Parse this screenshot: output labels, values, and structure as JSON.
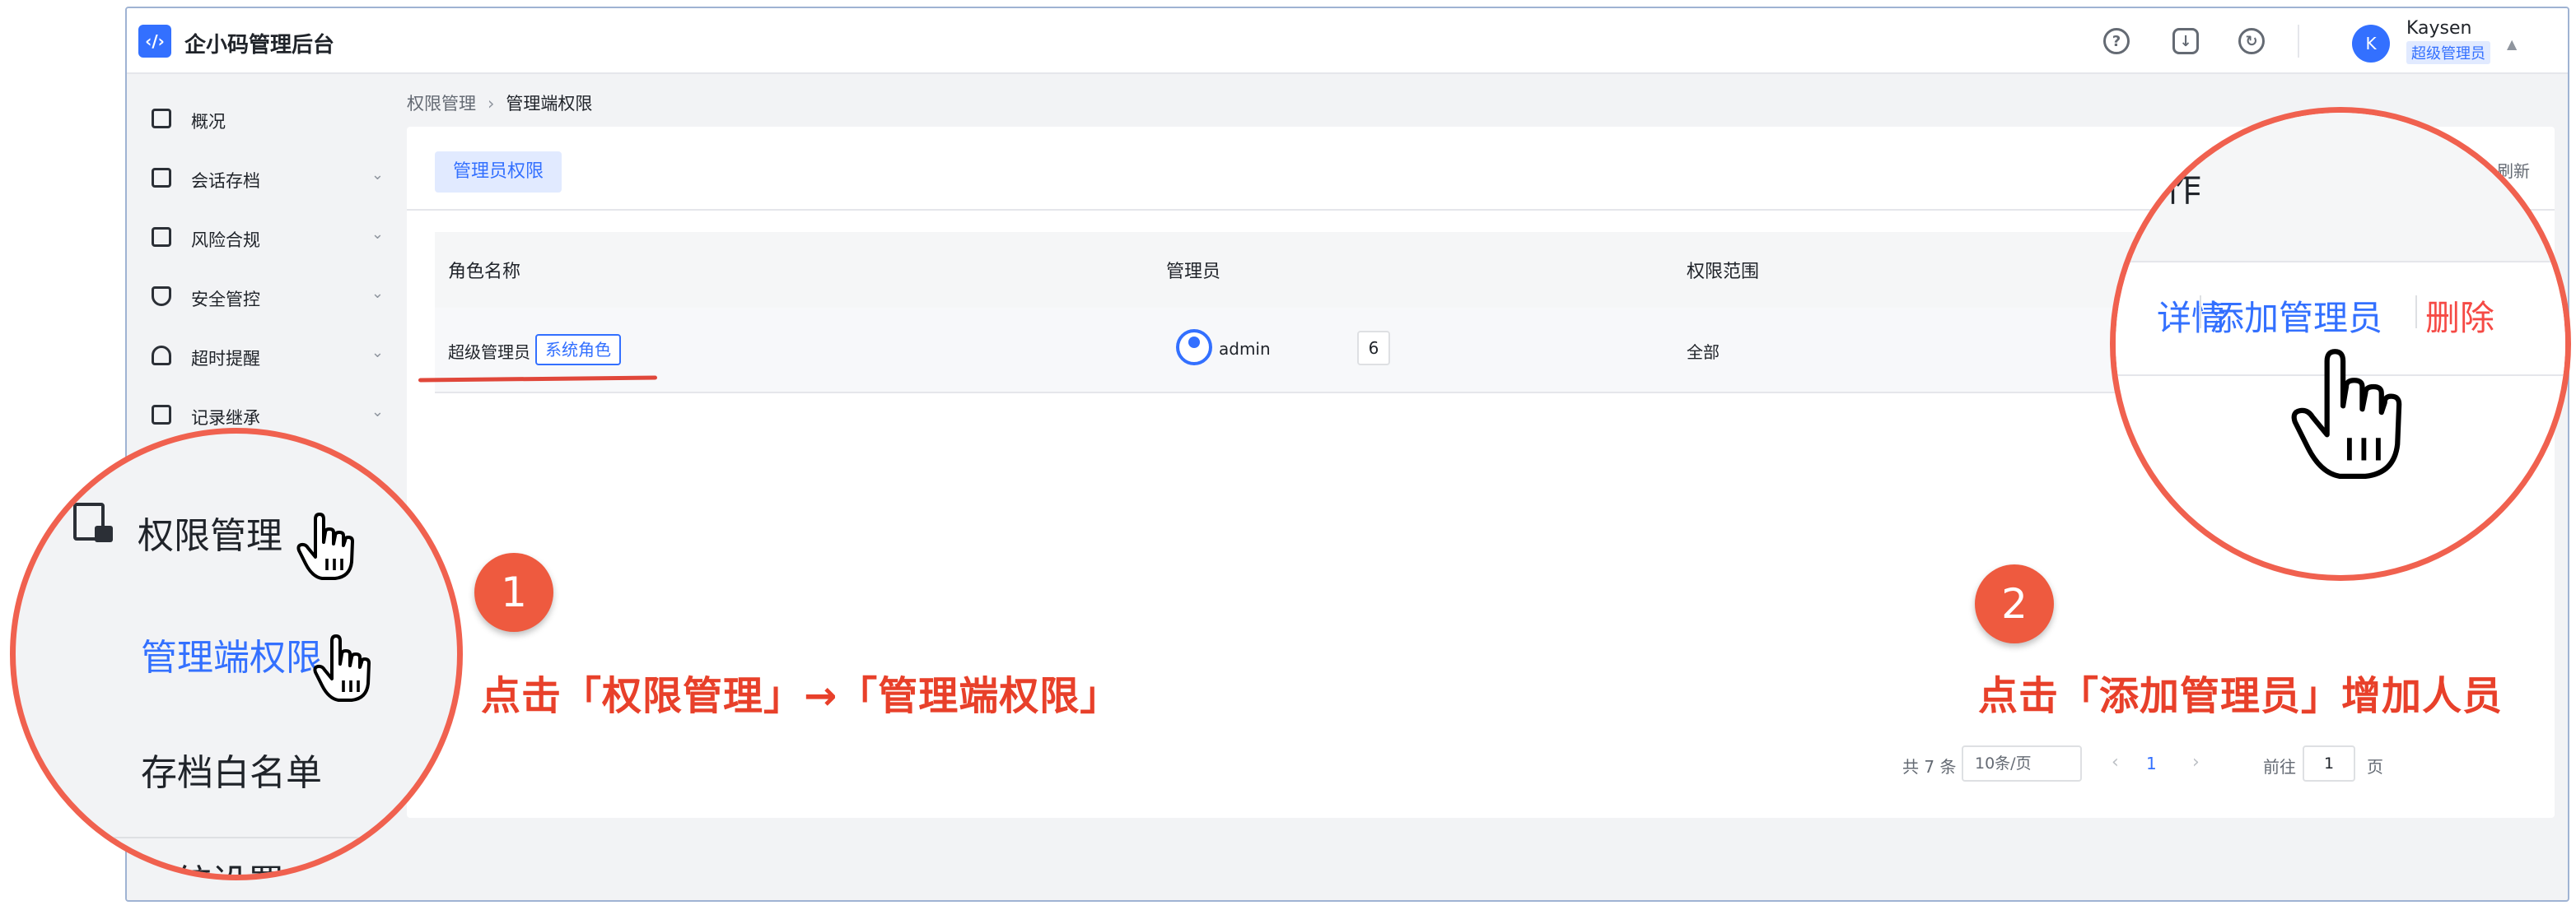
{
  "app": {
    "logo_glyph": "‹/›",
    "title": "企小码管理后台"
  },
  "header": {
    "icons": [
      "help-icon",
      "download-icon",
      "refresh-icon"
    ],
    "user": {
      "avatar_letter": "K",
      "name": "Kaysen",
      "role": "超级管理员"
    }
  },
  "sidebar": {
    "items": [
      {
        "label": "概况",
        "icon": "building-icon",
        "expandable": false
      },
      {
        "label": "会话存档",
        "icon": "folder-icon",
        "expandable": true
      },
      {
        "label": "风险合规",
        "icon": "alert-icon",
        "expandable": true
      },
      {
        "label": "安全管控",
        "icon": "shield-icon",
        "expandable": true
      },
      {
        "label": "超时提醒",
        "icon": "bell-icon",
        "expandable": true
      },
      {
        "label": "记录继承",
        "icon": "record-icon",
        "expandable": true
      }
    ]
  },
  "breadcrumb": {
    "parent": "权限管理",
    "current": "管理端权限"
  },
  "panel": {
    "tab": "管理员权限",
    "refresh_label": "刷新",
    "table": {
      "columns": [
        "角色名称",
        "管理员",
        "权限范围"
      ],
      "rows": [
        {
          "role": "超级管理员",
          "tag": "系统角色",
          "admin": "admin",
          "admin_count": "6",
          "scope": "全部"
        }
      ]
    },
    "pagination": {
      "total": "共 7 条",
      "page_size": "10条/页",
      "current_page": "1",
      "goto_label": "前往",
      "goto_value": "1",
      "unit": "页"
    }
  },
  "magnifier_left": {
    "perm_menu": "权限管理",
    "admin_perm": "管理端权限",
    "whitelist": "存档白名单",
    "system_settings": "系统设置"
  },
  "magnifier_right": {
    "header": "操作",
    "detail": "详情",
    "add_admin": "添加管理员",
    "delete": "删除"
  },
  "steps": [
    {
      "number": "1",
      "text": "点击「权限管理」→「管理端权限」"
    },
    {
      "number": "2",
      "text": "点击「添加管理员」增加人员"
    }
  ],
  "colors": {
    "accent": "#3370ff",
    "danger": "#f54a45",
    "annotation": "#e8402a"
  }
}
